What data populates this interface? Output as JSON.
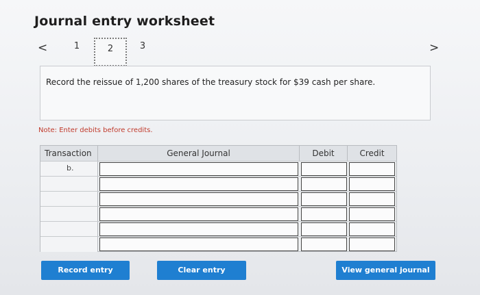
{
  "header": {
    "title": "Journal entry worksheet"
  },
  "nav": {
    "prev_icon": "<",
    "next_icon": ">",
    "steps": [
      "1",
      "2",
      "3"
    ],
    "active_step": "2"
  },
  "prompt": {
    "text": "Record the reissue of 1,200 shares of the treasury stock for $39 cash per share."
  },
  "note": {
    "text": "Note: Enter debits before credits."
  },
  "journal": {
    "columns": [
      "Transaction",
      "General Journal",
      "Debit",
      "Credit"
    ],
    "rows": [
      {
        "transaction": "b.",
        "account": "",
        "debit": "",
        "credit": ""
      },
      {
        "transaction": "",
        "account": "",
        "debit": "",
        "credit": ""
      },
      {
        "transaction": "",
        "account": "",
        "debit": "",
        "credit": ""
      },
      {
        "transaction": "",
        "account": "",
        "debit": "",
        "credit": ""
      },
      {
        "transaction": "",
        "account": "",
        "debit": "",
        "credit": ""
      },
      {
        "transaction": "",
        "account": "",
        "debit": "",
        "credit": ""
      }
    ]
  },
  "buttons": {
    "record": "Record entry",
    "clear": "Clear entry",
    "view": "View general journal"
  },
  "colors": {
    "button": "#1f7fd1",
    "note": "#c0392b"
  }
}
